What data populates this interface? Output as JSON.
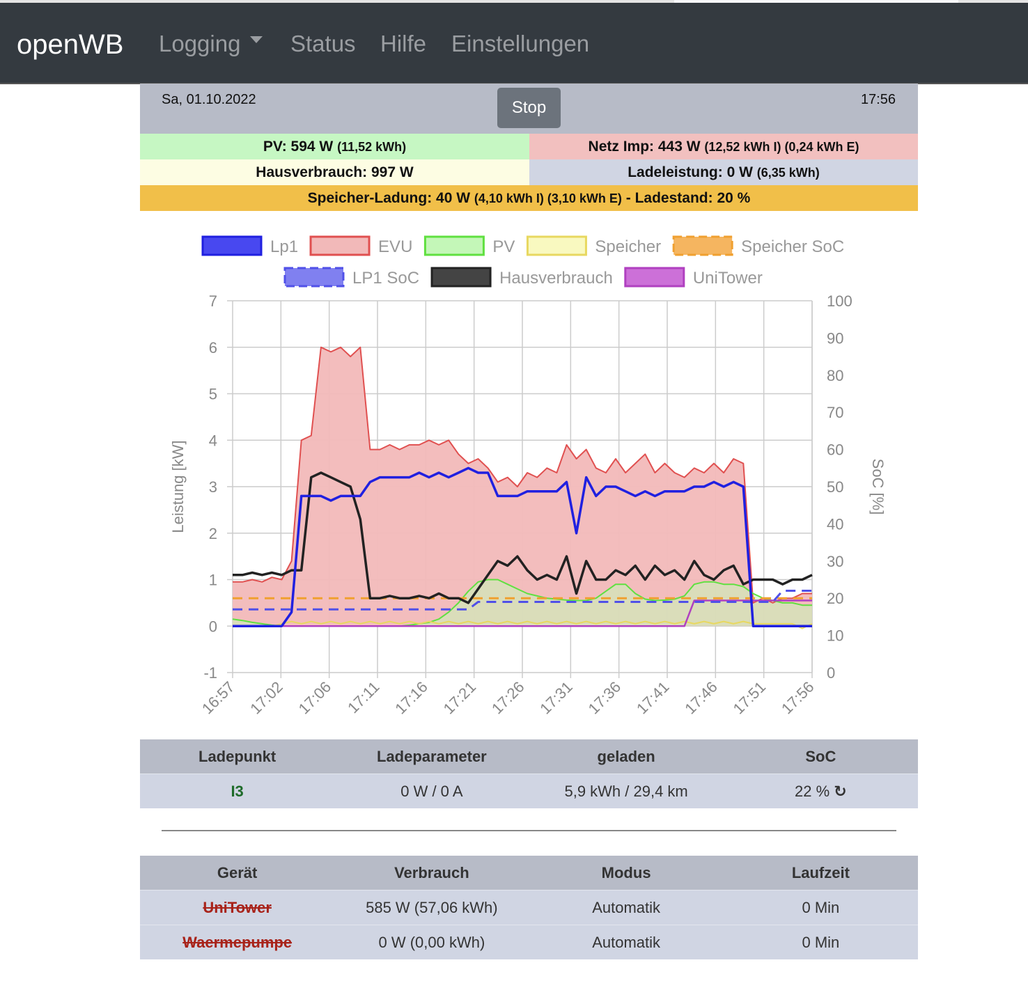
{
  "nav": {
    "brand": "openWB",
    "items": [
      "Logging",
      "Status",
      "Hilfe",
      "Einstellungen"
    ]
  },
  "header": {
    "date": "Sa, 01.10.2022",
    "time": "17:56",
    "stop_label": "Stop"
  },
  "summary": {
    "pv_main": "PV: 594 W",
    "pv_sub": "(11,52 kWh)",
    "netz_main": "Netz Imp: 443 W",
    "netz_sub": "(12,52 kWh I) (0,24 kWh E)",
    "haus_main": "Hausverbrauch: 997 W",
    "lade_main": "Ladeleistung: 0 W",
    "lade_sub": "(6,35 kWh)",
    "speicher_main": "Speicher-Ladung: 40 W",
    "speicher_sub": "(4,10 kWh I) (3,10 kWh E)",
    "speicher_end": "- Ladestand: 20 %",
    "colors": {
      "pv": "#c6f7c3",
      "netz": "#f2c0bf",
      "haus": "#fdfde3",
      "lade": "#d0d5e3",
      "speicher": "#f1bf49"
    }
  },
  "chart_data": {
    "type": "line",
    "ylabel": "Leistung [kW]",
    "y2label": "SoC [%]",
    "ylim": [
      -1,
      7
    ],
    "y2lim": [
      0,
      100
    ],
    "yticks": [
      "-1",
      "0",
      "1",
      "2",
      "3",
      "4",
      "5",
      "6",
      "7"
    ],
    "y2ticks": [
      "0",
      "10",
      "20",
      "30",
      "40",
      "50",
      "60",
      "70",
      "80",
      "90",
      "100"
    ],
    "xticks": [
      "16:57",
      "17:02",
      "17:06",
      "17:11",
      "17:16",
      "17:21",
      "17:26",
      "17:31",
      "17:36",
      "17:41",
      "17:46",
      "17:51",
      "17:56"
    ],
    "x_minutes": 60,
    "legend": [
      {
        "name": "Lp1",
        "color": "#2020e0",
        "fill": "#4848f0",
        "dash": false
      },
      {
        "name": "EVU",
        "color": "#e05050",
        "fill": "#f2b9b9",
        "dash": false
      },
      {
        "name": "PV",
        "color": "#60e040",
        "fill": "#c4f7b8",
        "dash": false
      },
      {
        "name": "Speicher",
        "color": "#e8d860",
        "fill": "#f9f9c0",
        "dash": false
      },
      {
        "name": "Speicher SoC",
        "color": "#f0a030",
        "fill": "#f5b560",
        "dash": true
      },
      {
        "name": "LP1 SoC",
        "color": "#5050e8",
        "fill": "#8080f0",
        "dash": true
      },
      {
        "name": "Hausverbrauch",
        "color": "#222",
        "fill": "#444",
        "dash": false
      },
      {
        "name": "UniTower",
        "color": "#b040c0",
        "fill": "#cc70d8",
        "dash": false
      }
    ],
    "series": {
      "EVU": [
        0.95,
        0.95,
        1.0,
        0.95,
        1.05,
        1.0,
        1.4,
        4.0,
        4.1,
        6.0,
        5.9,
        6.0,
        5.8,
        6.0,
        3.8,
        3.8,
        3.9,
        3.8,
        3.9,
        3.9,
        4.0,
        3.9,
        4.0,
        3.7,
        3.5,
        3.6,
        3.4,
        3.1,
        3.2,
        3.0,
        3.3,
        3.2,
        3.4,
        3.3,
        3.9,
        3.6,
        3.8,
        3.4,
        3.3,
        3.6,
        3.3,
        3.5,
        3.7,
        3.3,
        3.5,
        3.3,
        3.2,
        3.4,
        3.3,
        3.5,
        3.3,
        3.6,
        3.5,
        0.5,
        0.6,
        0.5,
        0.6,
        0.6,
        0.7,
        0.7
      ],
      "Lp1": [
        0,
        0,
        0,
        0,
        0,
        0,
        0.3,
        2.8,
        2.8,
        2.8,
        2.7,
        2.8,
        2.8,
        2.8,
        3.1,
        3.2,
        3.2,
        3.2,
        3.2,
        3.3,
        3.2,
        3.3,
        3.2,
        3.3,
        3.4,
        3.3,
        3.3,
        2.8,
        2.8,
        2.8,
        2.9,
        2.9,
        2.9,
        2.9,
        3.1,
        2.0,
        3.2,
        2.8,
        3.0,
        3.0,
        2.9,
        2.8,
        2.9,
        2.8,
        2.9,
        2.9,
        2.9,
        3.0,
        3.0,
        3.1,
        3.0,
        3.1,
        3.0,
        0,
        0,
        0,
        0,
        0,
        0,
        0
      ],
      "Hausverbrauch": [
        1.1,
        1.1,
        1.15,
        1.1,
        1.15,
        1.1,
        1.2,
        1.2,
        3.2,
        3.3,
        3.2,
        3.1,
        3.0,
        2.3,
        0.6,
        0.6,
        0.65,
        0.6,
        0.6,
        0.65,
        0.6,
        0.7,
        0.6,
        0.6,
        0.5,
        0.8,
        1.1,
        1.4,
        1.3,
        1.5,
        1.2,
        1.0,
        1.1,
        1.0,
        1.5,
        0.7,
        1.4,
        1.0,
        1.0,
        1.2,
        1.1,
        1.3,
        1.0,
        1.3,
        1.1,
        1.2,
        1.0,
        1.4,
        1.1,
        1.0,
        1.2,
        1.3,
        0.9,
        1.0,
        1.0,
        1.0,
        0.9,
        1.0,
        1.0,
        1.1
      ],
      "PV": [
        0.15,
        0.12,
        0.08,
        0.05,
        0.02,
        0,
        0,
        0,
        0,
        0,
        0,
        0,
        0,
        0,
        0,
        0,
        0,
        0,
        0.02,
        0.05,
        0.08,
        0.15,
        0.3,
        0.5,
        0.75,
        0.95,
        1.0,
        1.0,
        0.9,
        0.8,
        0.7,
        0.65,
        0.6,
        0.58,
        0.56,
        0.55,
        0.55,
        0.6,
        0.75,
        0.9,
        0.9,
        0.7,
        0.58,
        0.55,
        0.56,
        0.58,
        0.65,
        0.9,
        0.95,
        0.95,
        0.9,
        0.9,
        0.85,
        0.7,
        0.6,
        0.55,
        0.5,
        0.5,
        0.45,
        0.45
      ],
      "Speicher": [
        0,
        0,
        0,
        0,
        0,
        0.05,
        0.1,
        0.05,
        0.1,
        0.05,
        0.1,
        0.05,
        0.1,
        0.05,
        0.1,
        0.05,
        0.1,
        0.05,
        0.1,
        0.05,
        0.1,
        0.05,
        0.1,
        0.05,
        0.1,
        0.05,
        0.1,
        0.05,
        0.1,
        0.05,
        0.1,
        0.05,
        0.1,
        0.05,
        0.1,
        0.05,
        0.1,
        0.05,
        0.1,
        0.05,
        0.1,
        0.05,
        0.1,
        0.05,
        0.1,
        0.05,
        0.1,
        0.05,
        0.1,
        0.05,
        0.1,
        0.05,
        0.1,
        0.05,
        0.05,
        0.05,
        0.05,
        0.05,
        -0.05,
        0.05
      ],
      "UniTower": [
        0,
        0,
        0,
        0,
        0,
        0,
        0,
        0,
        0,
        0,
        0,
        0,
        0,
        0,
        0,
        0,
        0,
        0,
        0,
        0,
        0,
        0,
        0,
        0,
        0,
        0,
        0,
        0,
        0,
        0,
        0,
        0,
        0,
        0,
        0,
        0,
        0,
        0,
        0,
        0,
        0,
        0,
        0,
        0,
        0,
        0,
        0,
        0.55,
        0.55,
        0.55,
        0.55,
        0.55,
        0.55,
        0.55,
        0.55,
        0.55,
        0.55,
        0.55,
        0.55,
        0.55
      ],
      "LP1 SoC": [
        17,
        17,
        17,
        17,
        17,
        17,
        17,
        17,
        17,
        17,
        17,
        17,
        17,
        17,
        17,
        17,
        17,
        17,
        17,
        17,
        17,
        17,
        17,
        17,
        17,
        19,
        19,
        19,
        19,
        19,
        19,
        19,
        19,
        19,
        19,
        19,
        19,
        19,
        19,
        19,
        19,
        19,
        19,
        19,
        19,
        19,
        19,
        19,
        19,
        19,
        19,
        19,
        19,
        19,
        19,
        19,
        22,
        22,
        22,
        22
      ],
      "Speicher SoC": [
        20,
        20,
        20,
        20,
        20,
        20,
        20,
        20,
        20,
        20,
        20,
        20,
        20,
        20,
        20,
        20,
        20,
        20,
        20,
        20,
        20,
        20,
        20,
        20,
        20,
        20,
        20,
        20,
        20,
        20,
        20,
        20,
        20,
        20,
        20,
        20,
        20,
        20,
        20,
        20,
        20,
        20,
        20,
        20,
        20,
        20,
        20,
        20,
        20,
        20,
        20,
        20,
        20,
        20,
        20,
        20,
        20,
        20,
        20,
        20
      ]
    }
  },
  "ladepunkt_table": {
    "headers": [
      "Ladepunkt",
      "Ladeparameter",
      "geladen",
      "SoC"
    ],
    "rows": [
      {
        "name": "I3",
        "param": "0 W / 0 A",
        "geladen": "5,9 kWh / 29,4 km",
        "soc": "22 %"
      }
    ]
  },
  "geraete_table": {
    "headers": [
      "Gerät",
      "Verbrauch",
      "Modus",
      "Laufzeit"
    ],
    "rows": [
      {
        "name": "UniTower",
        "verbrauch": "585 W (57,06 kWh)",
        "modus": "Automatik",
        "laufzeit": "0 Min"
      },
      {
        "name": "Waermepumpe",
        "verbrauch": "0 W (0,00 kWh)",
        "modus": "Automatik",
        "laufzeit": "0 Min"
      }
    ]
  }
}
